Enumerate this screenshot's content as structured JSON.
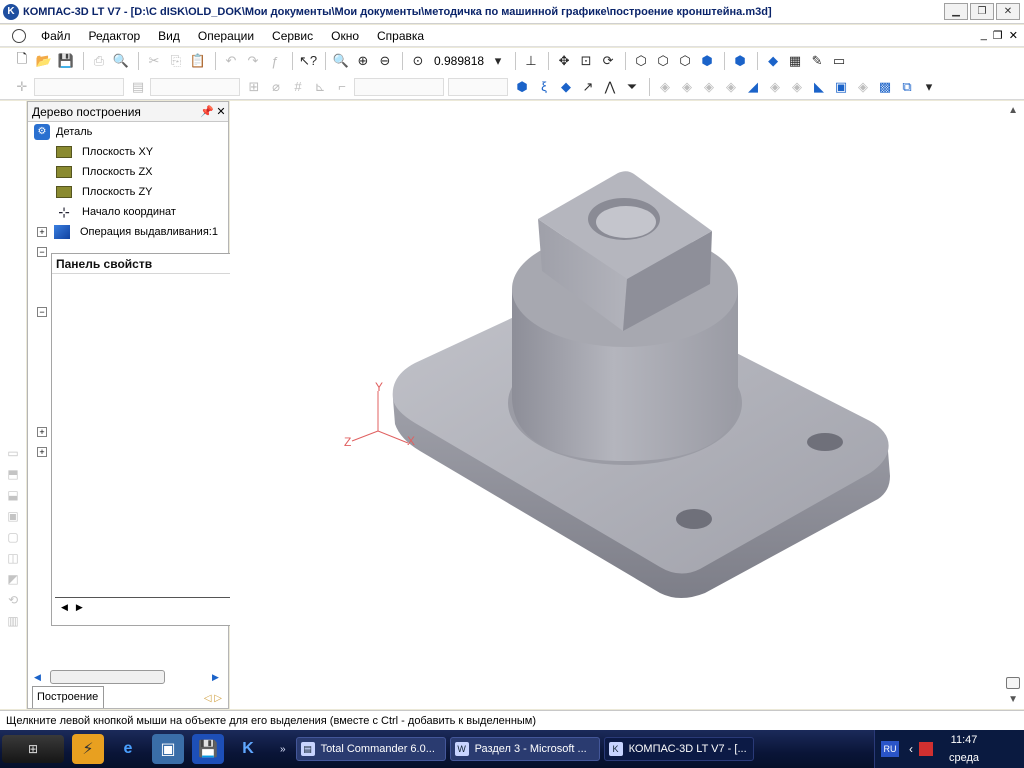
{
  "window": {
    "title": "КОМПАС-3D LT V7 - [D:\\C dISK\\OLD_DOK\\Мои документы\\Мои документы\\методичка по машинной графике\\построение кронштейна.m3d]"
  },
  "menu": {
    "items": [
      "Файл",
      "Редактор",
      "Вид",
      "Операции",
      "Сервис",
      "Окно",
      "Справка"
    ]
  },
  "toolbar": {
    "zoom_value": "0.989818"
  },
  "tree_panel": {
    "title": "Дерево построения",
    "root": "Деталь",
    "items": [
      "Плоскость XY",
      "Плоскость ZX",
      "Плоскость ZY",
      "Начало координат",
      "Операция выдавливания:1"
    ],
    "tab_label": "Построение"
  },
  "props_panel": {
    "title": "Панель свойств"
  },
  "viewport": {
    "axis_x": "X",
    "axis_y": "Y",
    "axis_z": "Z",
    "model_color": "#a9aab2",
    "axis_color": "#e06060"
  },
  "status": {
    "text": "Щелкните левой кнопкой мыши на объекте для его выделения (вместе с Ctrl - добавить к выделенным)"
  },
  "taskbar": {
    "tasks": [
      {
        "label": "Total Commander 6.0..."
      },
      {
        "label": "Раздел 3 - Microsoft ..."
      },
      {
        "label": "КОМПАС-3D LT V7 - [..."
      }
    ],
    "lang": "RU",
    "time": "11:47",
    "day": "среда"
  },
  "colors": {
    "accent": "#1b63c9",
    "title_text": "#0a246a"
  },
  "icons": {
    "app": "kompas-logo",
    "minimize": "minimize-icon",
    "maximize": "maximize-icon",
    "close": "close-icon"
  }
}
